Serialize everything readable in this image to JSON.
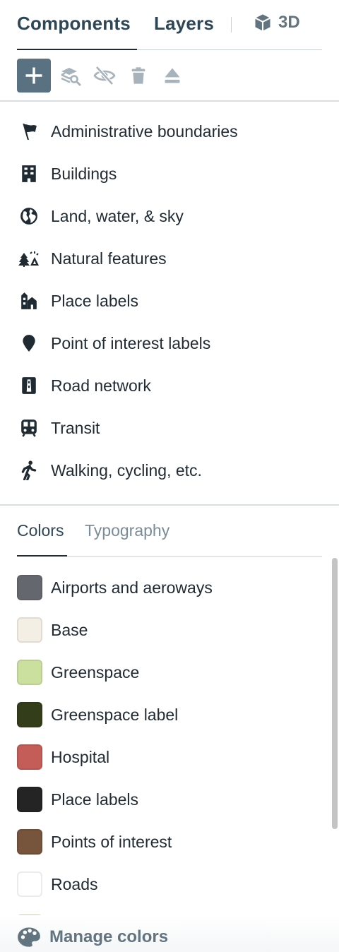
{
  "header": {
    "tabs": [
      {
        "label": "Components",
        "active": true
      },
      {
        "label": "Layers",
        "active": false
      },
      {
        "label": "3D",
        "icon": "cube-icon",
        "active": false
      }
    ]
  },
  "toolbar": {
    "buttons": [
      {
        "name": "add",
        "icon": "plus-icon"
      },
      {
        "name": "inspect-layers",
        "icon": "layers-search-icon"
      },
      {
        "name": "hide",
        "icon": "eye-off-icon"
      },
      {
        "name": "delete",
        "icon": "trash-icon"
      },
      {
        "name": "eject",
        "icon": "eject-icon"
      }
    ]
  },
  "components": [
    {
      "label": "Administrative boundaries",
      "icon": "flag-icon"
    },
    {
      "label": "Buildings",
      "icon": "building-icon"
    },
    {
      "label": "Land, water, & sky",
      "icon": "globe-icon"
    },
    {
      "label": "Natural features",
      "icon": "trees-mountain-icon"
    },
    {
      "label": "Place labels",
      "icon": "town-icon"
    },
    {
      "label": "Point of interest labels",
      "icon": "pin-icon"
    },
    {
      "label": "Road network",
      "icon": "road-icon"
    },
    {
      "label": "Transit",
      "icon": "train-icon"
    },
    {
      "label": "Walking, cycling, etc.",
      "icon": "pedestrian-icon"
    }
  ],
  "style_tabs": {
    "colors": "Colors",
    "typography": "Typography",
    "active": "colors"
  },
  "colors": [
    {
      "label": "Airports and aeroways",
      "color": "#64686e"
    },
    {
      "label": "Base",
      "color": "#f4efe4"
    },
    {
      "label": "Greenspace",
      "color": "#cbdf9f"
    },
    {
      "label": "Greenspace label",
      "color": "#333d19"
    },
    {
      "label": "Hospital",
      "color": "#c45c57"
    },
    {
      "label": "Place labels",
      "color": "#242424"
    },
    {
      "label": "Points of interest",
      "color": "#77543c"
    },
    {
      "label": "Roads",
      "color": "#ffffff"
    },
    {
      "label": "",
      "color": "#a08c45"
    }
  ],
  "footer": {
    "manage_label": "Manage colors",
    "icon": "palette-icon"
  },
  "theme": {
    "accent": "#5a7182",
    "text": "#1f2a33",
    "muted": "#7b8c98"
  }
}
